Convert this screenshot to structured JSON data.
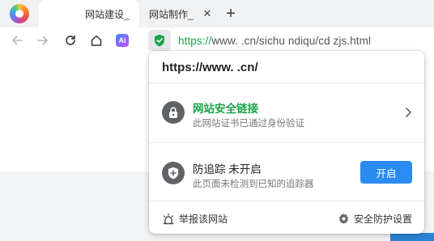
{
  "tabs": [
    {
      "title": "网站建设_",
      "active": true
    },
    {
      "title": "网站制作_",
      "active": false
    }
  ],
  "new_tab_label": "+",
  "toolbar": {
    "extension_label": "Ai"
  },
  "address_bar": {
    "scheme": "https://",
    "url_rest": "www.        .cn/sichu   ndiqu/cd   zjs.html"
  },
  "popup": {
    "host": "https://www.      .cn/",
    "security": {
      "title": "网站安全链接",
      "subtitle": "此网站证书已通过身份验证"
    },
    "tracking": {
      "title": "防追踪 未开启",
      "subtitle": "此页面未检测到已知的追踪器",
      "button": "开启"
    },
    "footer": {
      "report": "举报该网站",
      "settings": "安全防护设置"
    }
  },
  "colors": {
    "secure_green": "#1aa34a",
    "primary_blue": "#2a8bf2"
  }
}
